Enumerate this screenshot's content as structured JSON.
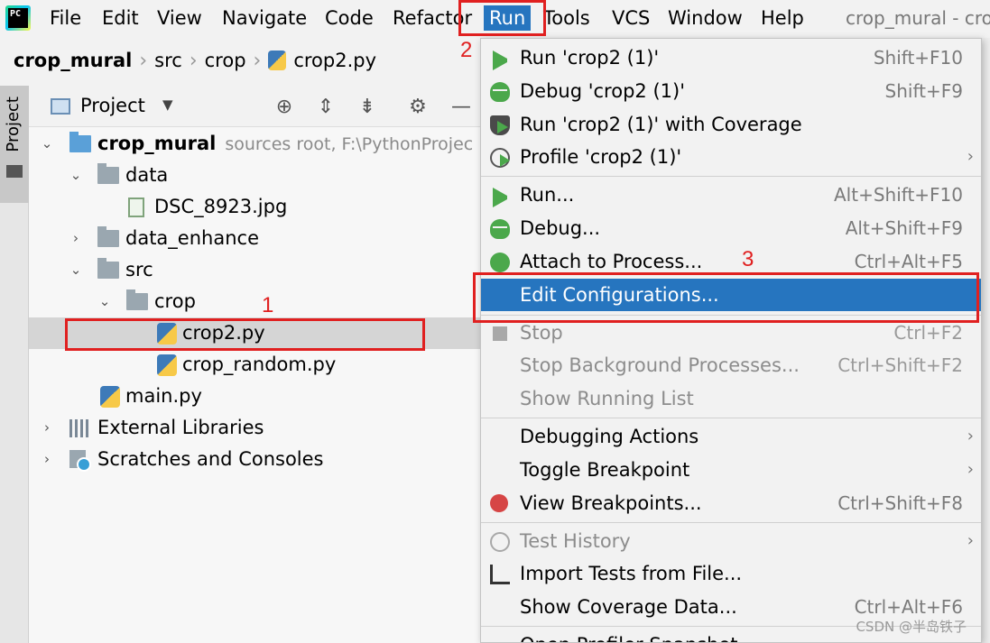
{
  "menubar": {
    "logo_text": "PC",
    "items": [
      "File",
      "Edit",
      "View",
      "Navigate",
      "Code",
      "Refactor",
      "Run",
      "Tools",
      "VCS",
      "Window",
      "Help"
    ],
    "active": "Run",
    "window_title": "crop_mural - cro"
  },
  "breadcrumb": [
    "crop_mural",
    "src",
    "crop",
    "crop2.py"
  ],
  "toolstrip": {
    "tab_label": "Project"
  },
  "project_panel": {
    "title": "Project",
    "tree": [
      {
        "label": "crop_mural",
        "hint": "sources root,  F:\\PythonProjec"
      },
      {
        "label": "data"
      },
      {
        "label": "DSC_8923.jpg"
      },
      {
        "label": "data_enhance"
      },
      {
        "label": "src"
      },
      {
        "label": "crop"
      },
      {
        "label": "crop2.py"
      },
      {
        "label": "crop_random.py"
      },
      {
        "label": "main.py"
      },
      {
        "label": "External Libraries"
      },
      {
        "label": "Scratches and Consoles"
      }
    ]
  },
  "run_menu": {
    "items": [
      {
        "label": "Run 'crop2 (1)'",
        "shortcut": "Shift+F10"
      },
      {
        "label": "Debug 'crop2 (1)'",
        "shortcut": "Shift+F9"
      },
      {
        "label": "Run 'crop2 (1)' with Coverage",
        "shortcut": ""
      },
      {
        "label": "Profile 'crop2 (1)'",
        "shortcut": ""
      },
      {
        "label": "Run...",
        "shortcut": "Alt+Shift+F10"
      },
      {
        "label": "Debug...",
        "shortcut": "Alt+Shift+F9"
      },
      {
        "label": "Attach to Process...",
        "shortcut": "Ctrl+Alt+F5"
      },
      {
        "label": "Edit Configurations...",
        "shortcut": ""
      },
      {
        "label": "Stop",
        "shortcut": "Ctrl+F2"
      },
      {
        "label": "Stop Background Processes...",
        "shortcut": "Ctrl+Shift+F2"
      },
      {
        "label": "Show Running List",
        "shortcut": ""
      },
      {
        "label": "Debugging Actions",
        "shortcut": ""
      },
      {
        "label": "Toggle Breakpoint",
        "shortcut": ""
      },
      {
        "label": "View Breakpoints...",
        "shortcut": "Ctrl+Shift+F8"
      },
      {
        "label": "Test History",
        "shortcut": ""
      },
      {
        "label": "Import Tests from File...",
        "shortcut": ""
      },
      {
        "label": "Show Coverage Data...",
        "shortcut": "Ctrl+Alt+F6"
      },
      {
        "label": "Open Profiler Snapshot",
        "shortcut": ""
      }
    ],
    "highlighted": "Edit Configurations..."
  },
  "annotations": {
    "step1": "1",
    "step2": "2",
    "step3": "3"
  },
  "watermark": "CSDN @半岛铁子",
  "colors": {
    "selection_blue": "#2675bf",
    "annotation_red": "#e02020",
    "run_green": "#4ba84b"
  }
}
